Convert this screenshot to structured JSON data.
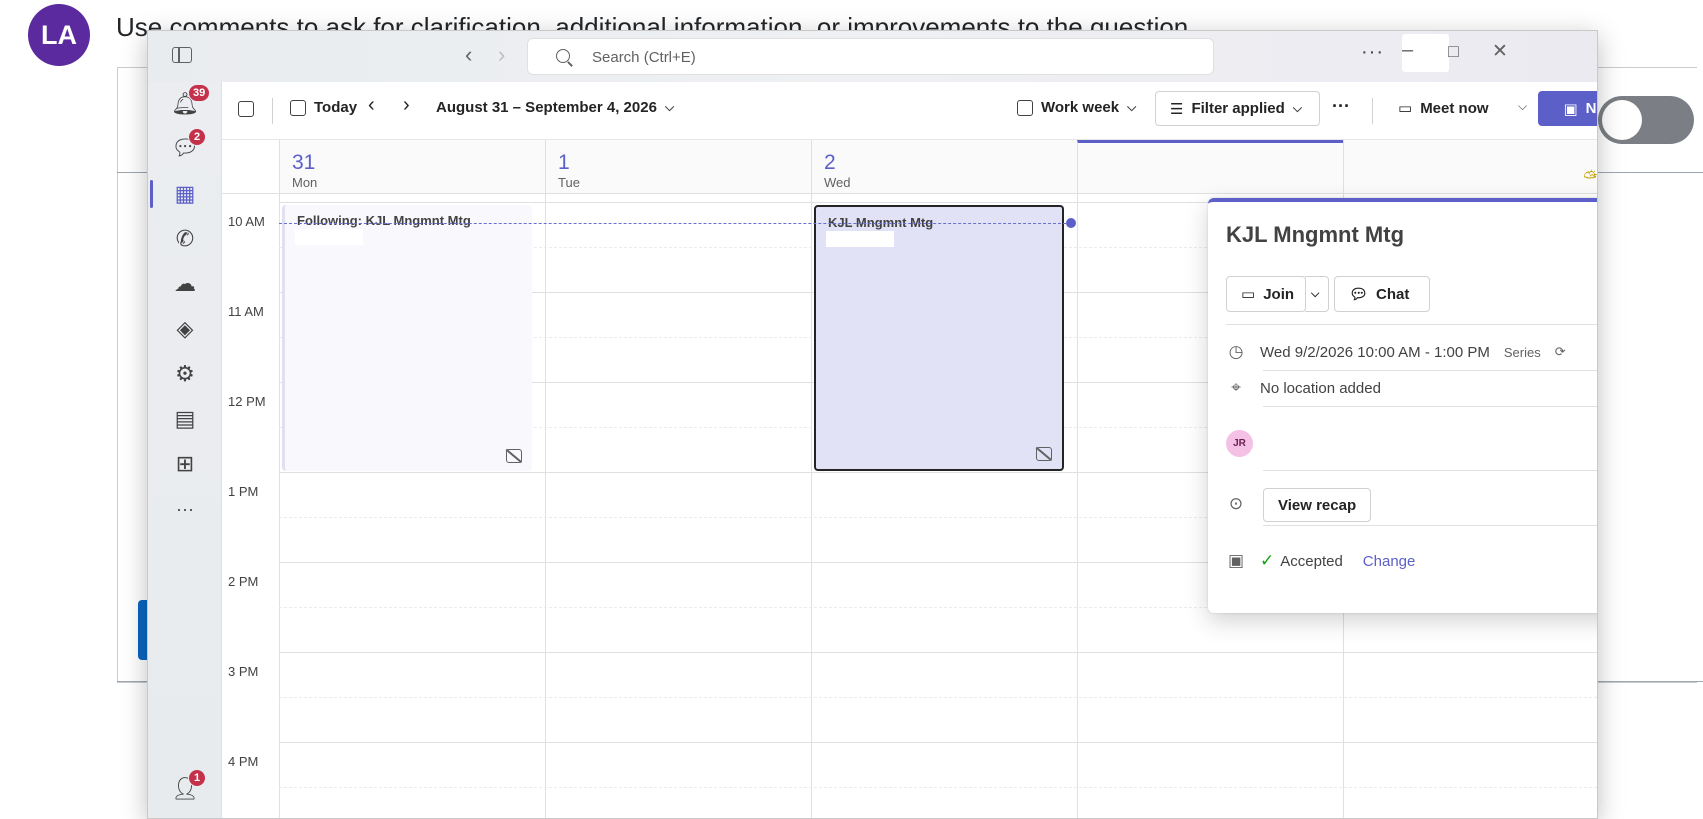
{
  "background": {
    "avatar_initials": "LA",
    "comment_text": "Use comments to ask for clarification, additional information, or improvements to the question."
  },
  "titlebar": {
    "search_placeholder": "Search (Ctrl+E)",
    "more_label": "···"
  },
  "rail": {
    "activity_badge": "39",
    "chat_badge": "2",
    "people_badge": "1",
    "more_label": "···"
  },
  "calendar_header": {
    "today_label": "Today",
    "date_range": "August 31 – September 4, 2026",
    "view_label": "Work week",
    "filter_label": "Filter applied",
    "more_label": "···",
    "meet_now_label": "Meet now",
    "new_label": "New"
  },
  "days": [
    {
      "num": "31",
      "name": "Mon"
    },
    {
      "num": "1",
      "name": "Tue"
    },
    {
      "num": "2",
      "name": "Wed"
    },
    {
      "num": "",
      "name": ""
    },
    {
      "num": "",
      "name": ""
    }
  ],
  "times": [
    "10 AM",
    "11 AM",
    "12 PM",
    "1 PM",
    "2 PM",
    "3 PM",
    "4 PM"
  ],
  "events": {
    "mon_title": "Following: KJL Mngmnt Mtg",
    "wed_title": "KJL Mngmnt Mtg"
  },
  "card": {
    "title": "KJL Mngmnt Mtg",
    "join_label": "Join",
    "chat_label": "Chat",
    "datetime": "Wed 9/2/2026 10:00 AM - 1:00 PM",
    "series_label": "Series",
    "location": "No location added",
    "attendee_initials": "JR",
    "recap_label": "View recap",
    "status_label": "Accepted",
    "change_label": "Change"
  },
  "colors": {
    "brand": "#5b5fc7",
    "event_fill": "#e2e2f6",
    "badge": "#c4314b",
    "accepted_check": "#13a10e"
  }
}
